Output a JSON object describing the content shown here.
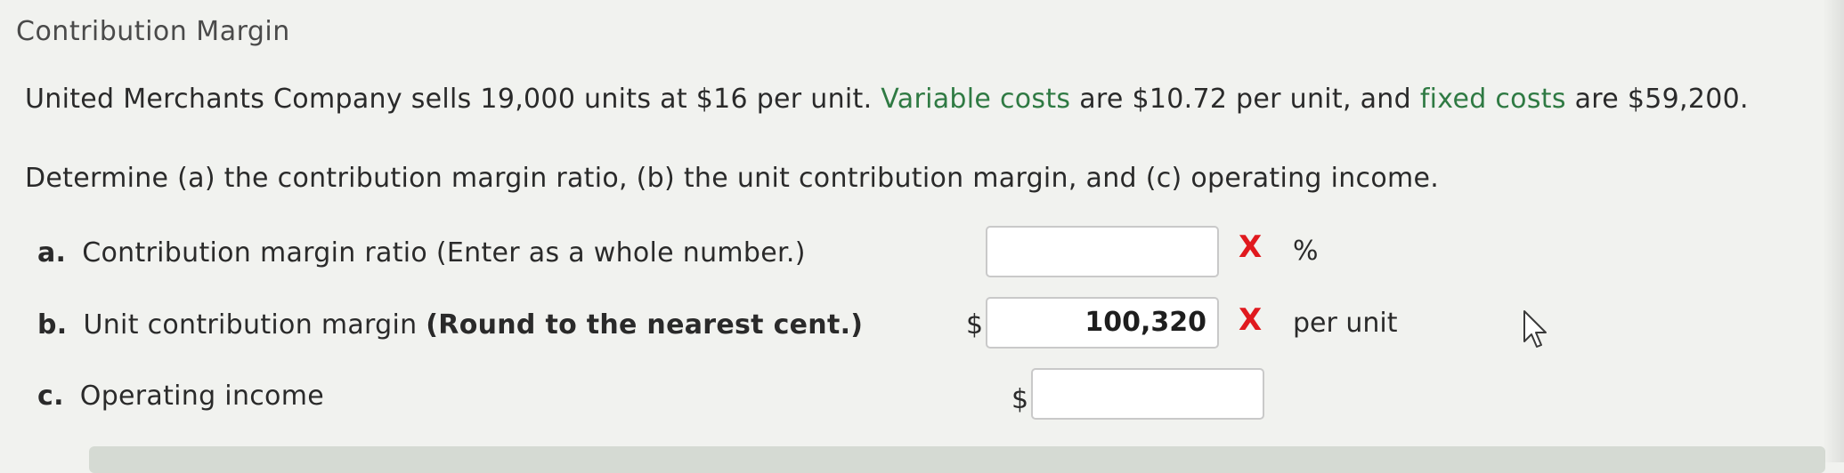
{
  "title": "Contribution Margin",
  "intro": {
    "part1": "United Merchants Company sells 19,000 units at $16 per unit. ",
    "variable_costs_term": "Variable costs",
    "part2": " are $10.72 per unit, and ",
    "fixed_costs_term": "fixed costs",
    "part3": " are $59,200."
  },
  "question": "Determine (a) the contribution margin ratio, (b) the unit contribution margin, and (c) operating income.",
  "rows": [
    {
      "letter": "a.",
      "label": "Contribution margin ratio (Enter as a whole number.)",
      "value": "",
      "unit": "%",
      "marked_wrong": true
    },
    {
      "letter": "b.",
      "label": "Unit contribution margin ",
      "label_bold": "(Round to the nearest cent.)",
      "prefix": "$",
      "value": "100,320",
      "unit": "per unit",
      "marked_wrong": true
    },
    {
      "letter": "c.",
      "label": "Operating income",
      "prefix": "$",
      "value": ""
    }
  ],
  "x_mark": "X",
  "colors": {
    "green_term": "#2f7a43",
    "wrong_mark": "#e0191e"
  }
}
